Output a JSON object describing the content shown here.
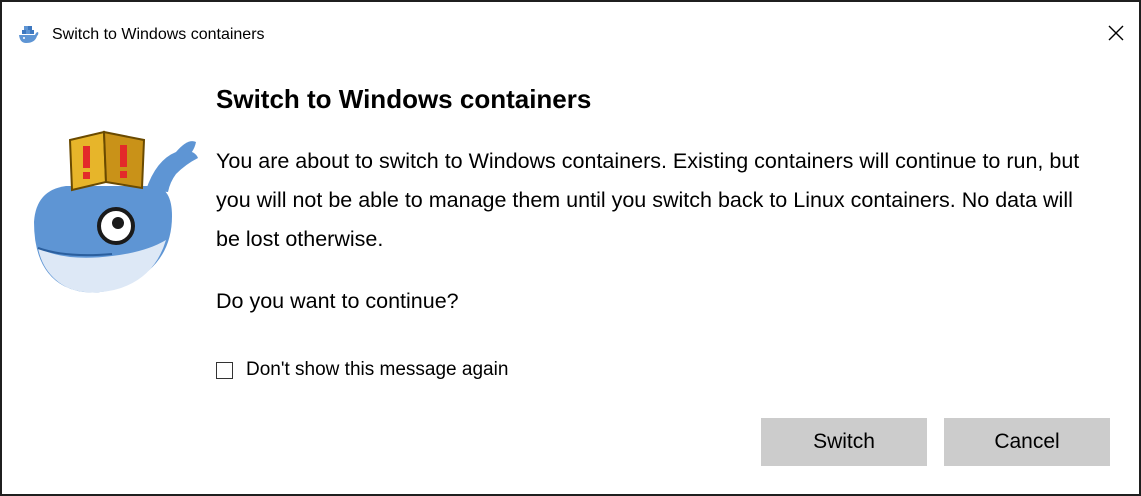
{
  "window": {
    "title": "Switch to Windows containers",
    "icon": "docker-whale-icon",
    "close_glyph": "✕"
  },
  "dialog": {
    "heading": "Switch to Windows containers",
    "message": "You are about to switch to Windows containers. Existing containers will continue to run, but you will not be able to manage them until you switch back to Linux containers. No data will be lost otherwise.",
    "question": "Do you want to continue?",
    "checkbox": {
      "label": "Don't show this message again",
      "checked": false
    },
    "illustration": "docker-whale-warning-icon"
  },
  "buttons": {
    "switch_label": "Switch",
    "cancel_label": "Cancel"
  },
  "colors": {
    "button_bg": "#cccccc",
    "whale_blue": "#5e95d4",
    "box_yellow": "#e7b52a",
    "box_dark_yellow": "#c99218",
    "exclamation_red": "#e32a2a"
  }
}
